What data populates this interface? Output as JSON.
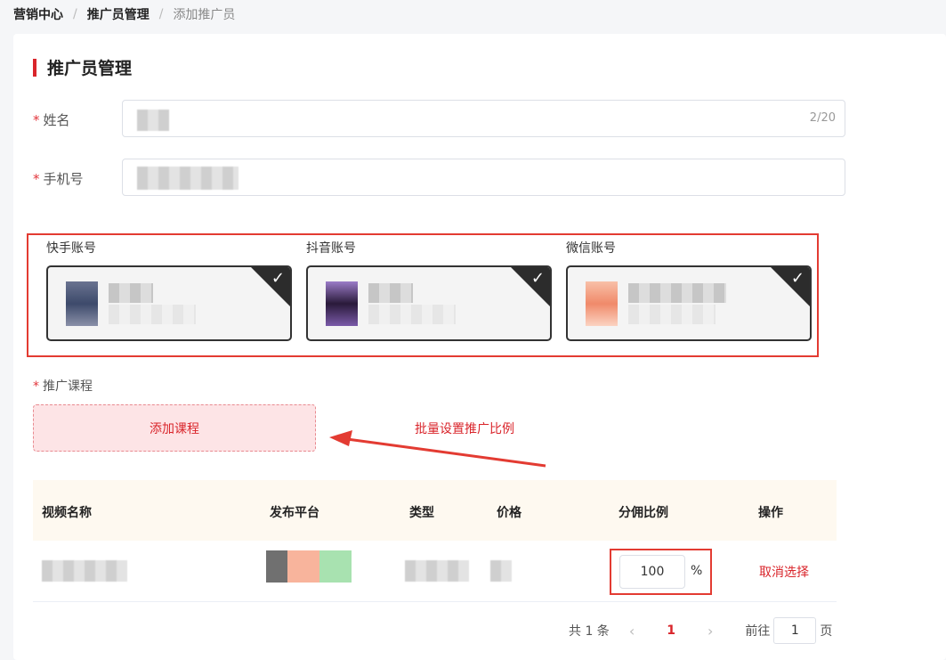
{
  "breadcrumb": {
    "item1": "营销中心",
    "item2": "推广员管理",
    "current": "添加推广员",
    "sep": "/"
  },
  "page": {
    "title": "推广员管理"
  },
  "form": {
    "name_label": "姓名",
    "name_counter": "2/20",
    "phone_label": "手机号",
    "required_mark": "*"
  },
  "accounts": [
    {
      "label": "快手账号",
      "checked": true,
      "icon": "checkmark-icon"
    },
    {
      "label": "抖音账号",
      "checked": true,
      "icon": "checkmark-icon"
    },
    {
      "label": "微信账号",
      "checked": true,
      "icon": "checkmark-icon"
    }
  ],
  "course": {
    "label": "推广课程",
    "add_button": "添加课程",
    "batch_link": "批量设置推广比例"
  },
  "table": {
    "headers": [
      "视频名称",
      "发布平台",
      "类型",
      "价格",
      "分佣比例",
      "操作"
    ],
    "rows": [
      {
        "ratio": "100",
        "unit": "%",
        "action": "取消选择"
      }
    ]
  },
  "pagination": {
    "total": "共 1 条",
    "prev": "‹",
    "current": "1",
    "next": "›",
    "goto_label": "前往",
    "goto_value": "1",
    "page_suffix": "页"
  },
  "colors": {
    "accent": "#d9252b",
    "highlight_border": "#e33b32",
    "table_header_bg": "#fef9f0"
  }
}
